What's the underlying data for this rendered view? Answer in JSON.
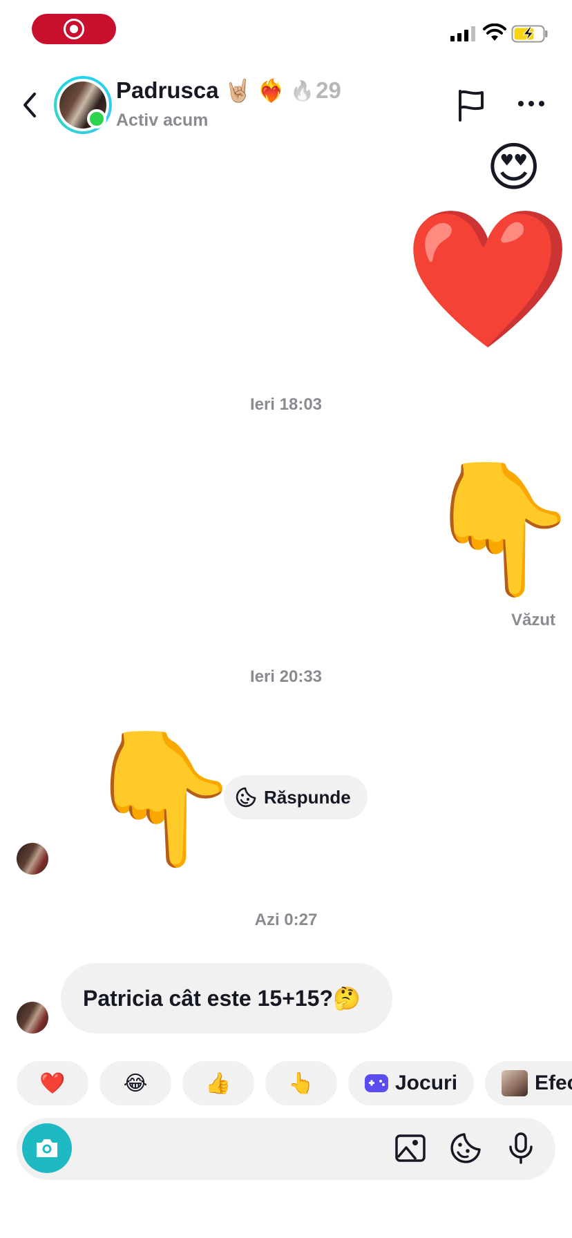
{
  "status_bar": {
    "recording_indicator": "screen-record",
    "signal_icon": "cellular-signal-icon",
    "wifi_icon": "wifi-icon",
    "battery_icon": "battery-charging-icon"
  },
  "header": {
    "name": "Padrusca",
    "name_emojis": [
      "🤘🏼",
      "❤️‍🔥"
    ],
    "streak_icon": "🔥",
    "streak_count": "29",
    "status": "Activ acum"
  },
  "messages": [
    {
      "side": "right",
      "type": "emoji",
      "content": "😍"
    },
    {
      "side": "right",
      "type": "emoji",
      "content": "❤️"
    },
    {
      "type": "timestamp",
      "content": "Ieri 18:03"
    },
    {
      "side": "right",
      "type": "emoji",
      "content": "👇"
    },
    {
      "type": "seen",
      "content": "Văzut"
    },
    {
      "type": "timestamp",
      "content": "Ieri 20:33"
    },
    {
      "side": "left",
      "type": "emoji",
      "content": "👇"
    },
    {
      "type": "timestamp",
      "content": "Azi 0:27"
    },
    {
      "side": "left",
      "type": "text",
      "content": "Patricia cât este 15+15?🤔"
    }
  ],
  "reply_chip": {
    "label": "Răspunde"
  },
  "quick_reactions": [
    "❤️",
    "😂",
    "👍",
    "👆"
  ],
  "quick_actions": {
    "games": "Jocuri",
    "effects": "Efec"
  },
  "colors": {
    "accent_teal": "#1fb9c4",
    "online_green": "#2bd44a",
    "record_red": "#c8102e",
    "bubble_gray": "#f1f1f2",
    "muted_text": "#8a8b91"
  }
}
